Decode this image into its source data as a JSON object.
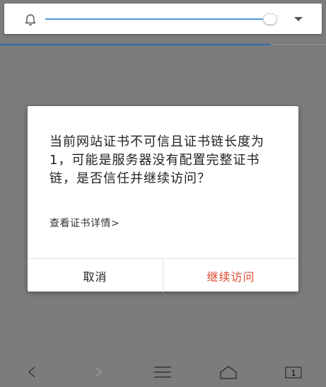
{
  "top_panel": {
    "icon": "bell-icon",
    "slider_level": 0.98,
    "dropdown_icon": "dropdown-arrow-icon",
    "accent_color": "#4d9be0"
  },
  "page_progress": 0.83,
  "dialog": {
    "message": "当前网站证书不可信且证书链长度为1，可能是服务器没有配置完整证书链，是否信任并继续访问？",
    "details_link": "查看证书详情>",
    "cancel_label": "取消",
    "continue_label": "继续访问",
    "continue_color": "#e0482f"
  },
  "bottom_nav": {
    "back_icon": "back-icon",
    "forward_icon": "forward-icon",
    "menu_icon": "menu-icon",
    "home_icon": "home-icon",
    "tabs_icon": "tabs-icon",
    "tab_count": "1"
  }
}
